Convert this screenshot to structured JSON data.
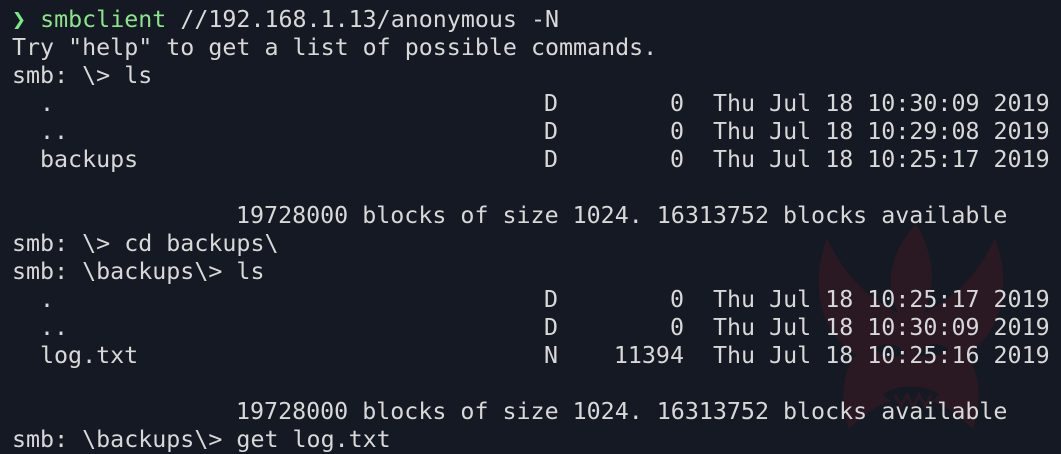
{
  "command": {
    "prompt_symbol": "❯",
    "program": "smbclient",
    "arguments": " //192.168.1.13/anonymous -N"
  },
  "help_text": "Try \"help\" to get a list of possible commands.",
  "session": [
    {
      "type": "prompt",
      "text": "smb: \\> ls"
    },
    {
      "type": "listing",
      "rows": [
        {
          "name": ".",
          "type": "D",
          "size": "0",
          "date": "Thu Jul 18 10:30:09 2019"
        },
        {
          "name": "..",
          "type": "D",
          "size": "0",
          "date": "Thu Jul 18 10:29:08 2019"
        },
        {
          "name": "backups",
          "type": "D",
          "size": "0",
          "date": "Thu Jul 18 10:25:17 2019"
        }
      ]
    },
    {
      "type": "blank"
    },
    {
      "type": "stats",
      "text": "19728000 blocks of size 1024. 16313752 blocks available"
    },
    {
      "type": "prompt",
      "text": "smb: \\> cd backups\\"
    },
    {
      "type": "prompt",
      "text": "smb: \\backups\\> ls"
    },
    {
      "type": "listing",
      "rows": [
        {
          "name": ".",
          "type": "D",
          "size": "0",
          "date": "Thu Jul 18 10:25:17 2019"
        },
        {
          "name": "..",
          "type": "D",
          "size": "0",
          "date": "Thu Jul 18 10:30:09 2019"
        },
        {
          "name": "log.txt",
          "type": "N",
          "size": "11394",
          "date": "Thu Jul 18 10:25:16 2019"
        }
      ]
    },
    {
      "type": "blank"
    },
    {
      "type": "stats",
      "text": "19728000 blocks of size 1024. 16313752 blocks available"
    },
    {
      "type": "prompt",
      "text": "smb: \\backups\\> get log.txt"
    }
  ],
  "theme": {
    "background": "#151923",
    "foreground": "#d8d8d8",
    "accent": "#7ee787",
    "watermark": "#9a1c25"
  },
  "watermark_icon": "horned-mask-icon"
}
